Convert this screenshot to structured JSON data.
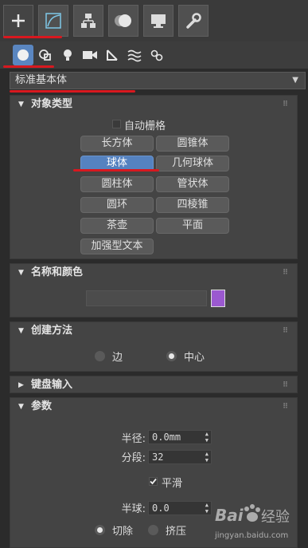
{
  "tabs": [
    {
      "name": "create",
      "icon": "plus-icon"
    },
    {
      "name": "modify",
      "icon": "modify-icon"
    },
    {
      "name": "hierarchy",
      "icon": "hierarchy-icon"
    },
    {
      "name": "motion",
      "icon": "motion-icon"
    },
    {
      "name": "display",
      "icon": "display-icon"
    },
    {
      "name": "utilities",
      "icon": "wrench-icon"
    }
  ],
  "category_icons": [
    "geometry-icon",
    "shapes-icon",
    "lights-icon",
    "cameras-icon",
    "helpers-icon",
    "spacewarps-icon",
    "systems-icon"
  ],
  "dropdown": {
    "value": "标准基本体"
  },
  "object_type": {
    "title": "对象类型",
    "autogrid_label": "自动栅格",
    "buttons": [
      "长方体",
      "圆锥体",
      "球体",
      "几何球体",
      "圆柱体",
      "管状体",
      "圆环",
      "四棱锥",
      "茶壶",
      "平面",
      "加强型文本"
    ],
    "selected": "球体"
  },
  "name_color": {
    "title": "名称和颜色",
    "name_value": "",
    "color": "#9b59d0"
  },
  "creation_method": {
    "title": "创建方法",
    "options": [
      "边",
      "中心"
    ],
    "selected": "中心"
  },
  "keyboard_entry": {
    "title": "键盘输入"
  },
  "parameters": {
    "title": "参数",
    "radius_label": "半径:",
    "radius_value": "0.0mm",
    "segments_label": "分段:",
    "segments_value": "32",
    "smooth_label": "平滑",
    "hemisphere_label": "半球:",
    "hemisphere_value": "0.0",
    "chop_label": "切除",
    "squash_label": "挤压"
  },
  "watermark": {
    "line1": "Bai",
    "line2": "经验",
    "url": "jingyan.baidu.com"
  },
  "colors": {
    "selected": "#5582c0",
    "annotation": "#d8181f"
  }
}
